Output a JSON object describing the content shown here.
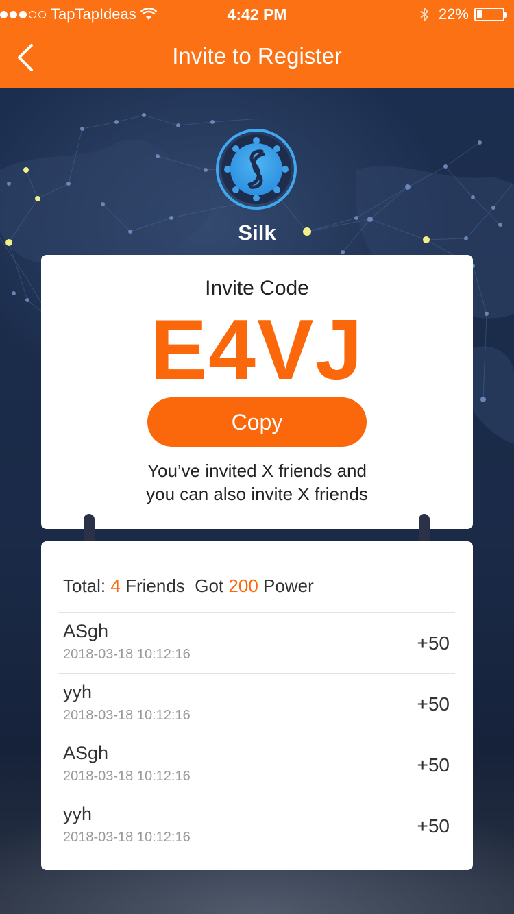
{
  "status_bar": {
    "carrier": "TapTapIdeas",
    "time": "4:42 PM",
    "battery": "22%",
    "battery_level": 0.22,
    "signal_bars": 3
  },
  "nav": {
    "back_icon": "chevron-left-icon",
    "title": "Invite to Register"
  },
  "app": {
    "name": "Silk",
    "logo_icon": "silk-logo-icon"
  },
  "invite": {
    "label": "Invite Code",
    "code": "E4VJ",
    "copy_label": "Copy",
    "note_line1": "You’ve invited X friends and",
    "note_line2": "you can also invite X friends"
  },
  "summary": {
    "total_prefix": "Total:",
    "total_count": "4",
    "friends_label": "Friends",
    "got_label": "Got",
    "power_count": "200",
    "power_label": "Power"
  },
  "friends": [
    {
      "name": "ASgh",
      "date": "2018-03-18 10:12:16",
      "points": "+50"
    },
    {
      "name": "yyh",
      "date": "2018-03-18 10:12:16",
      "points": "+50"
    },
    {
      "name": "ASgh",
      "date": "2018-03-18 10:12:16",
      "points": "+50"
    },
    {
      "name": "yyh",
      "date": "2018-03-18 10:12:16",
      "points": "+50"
    }
  ],
  "colors": {
    "accent": "#fb680b",
    "header": "#fb7114",
    "background": "#1b2a44"
  }
}
